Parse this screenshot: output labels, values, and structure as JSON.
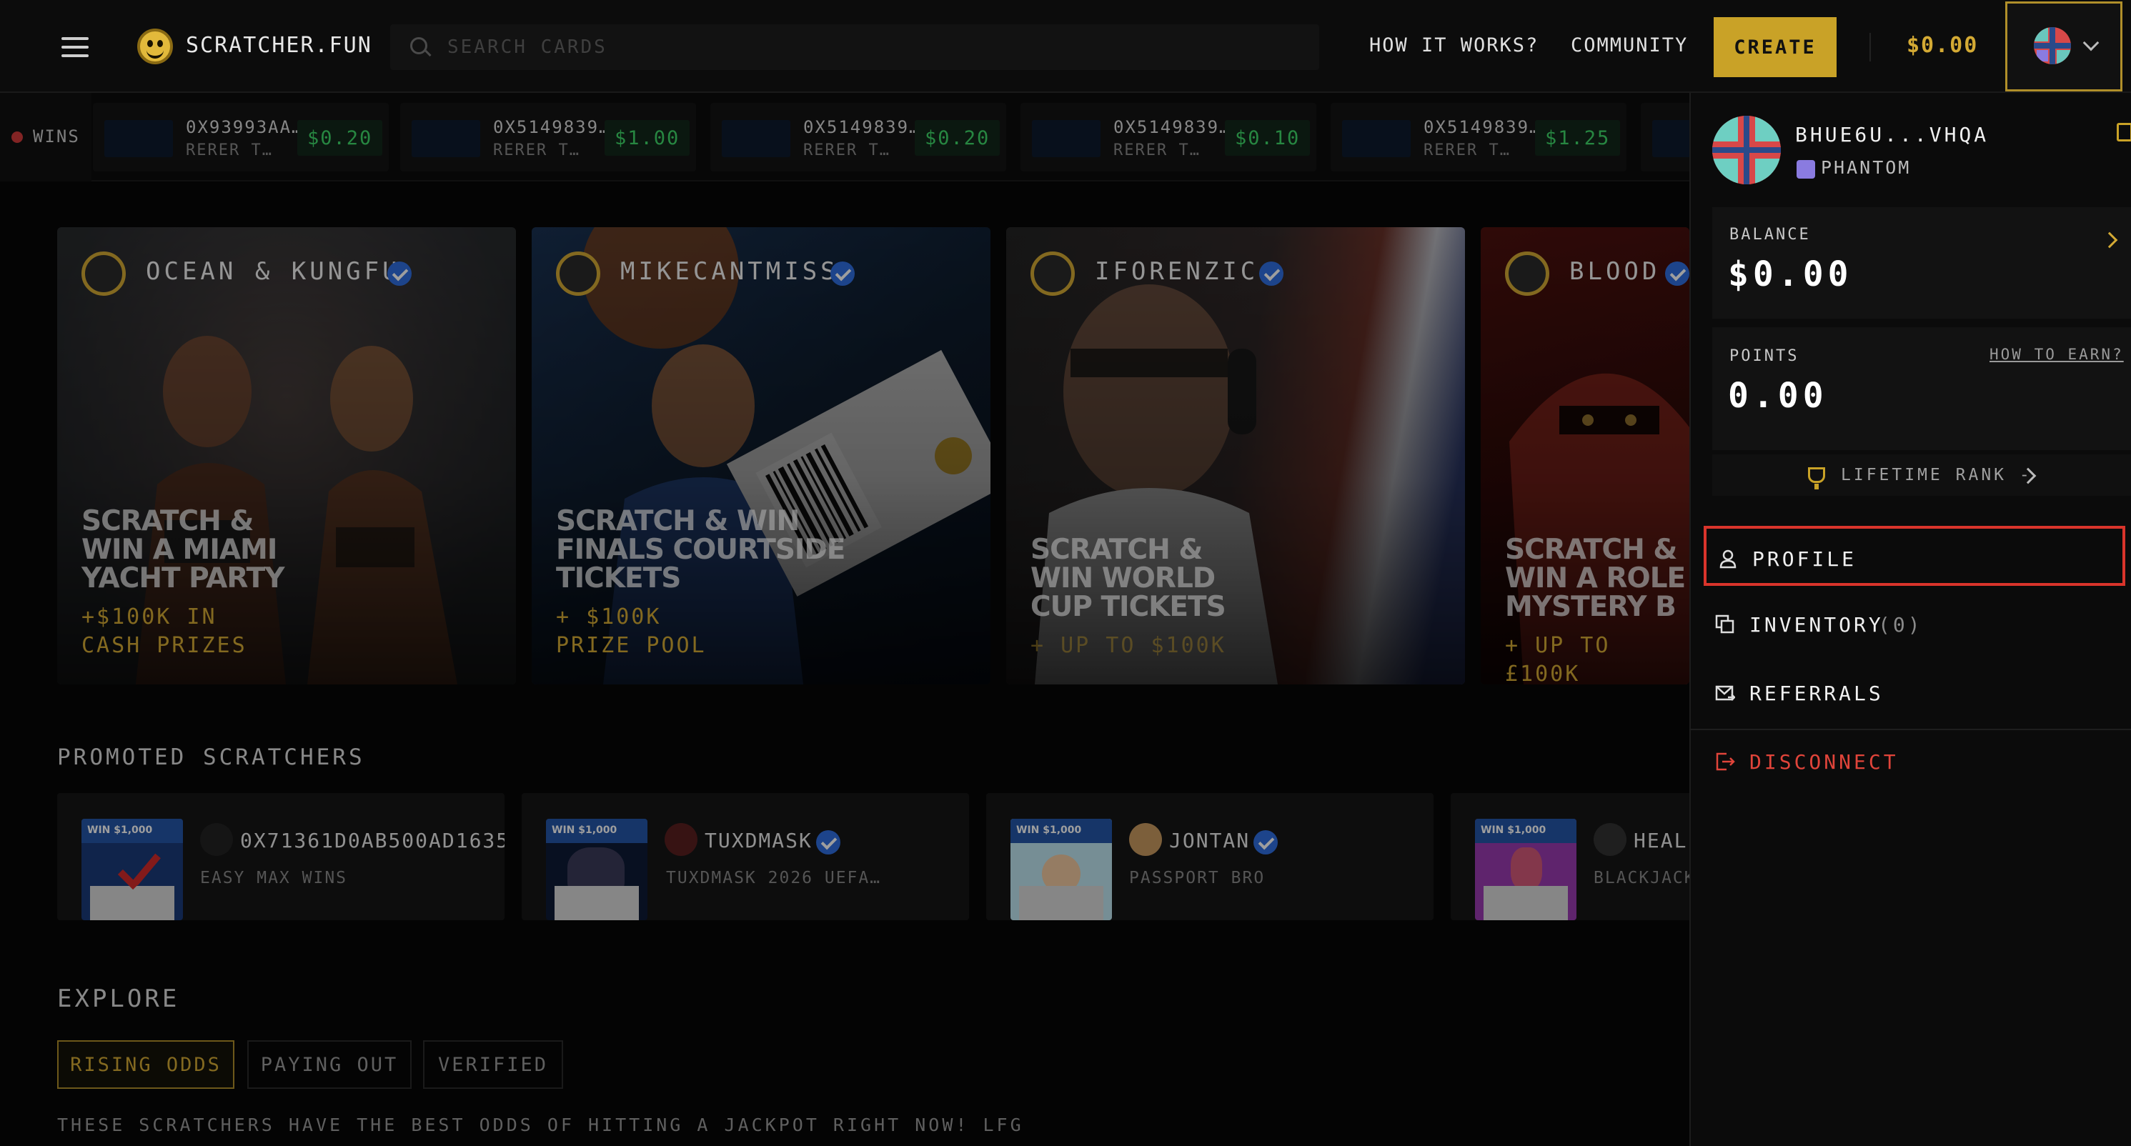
{
  "header": {
    "logo_text": "SCRATCHER.FUN",
    "search_placeholder": "SEARCH CARDS",
    "nav": [
      "HOW IT WORKS?",
      "COMMUNITY"
    ],
    "create_label": "CREATE",
    "balance": "$0.00",
    "accent_color": "#c9a227"
  },
  "wins_bar": {
    "label": "WINS",
    "items": [
      {
        "address": "0X93993AA…",
        "name": "RERER T…",
        "amount": "$0.20"
      },
      {
        "address": "0X5149839…",
        "name": "RERER T…",
        "amount": "$1.00"
      },
      {
        "address": "0X5149839…",
        "name": "RERER T…",
        "amount": "$0.20"
      },
      {
        "address": "0X5149839…",
        "name": "RERER T…",
        "amount": "$0.10"
      },
      {
        "address": "0X5149839…",
        "name": "RERER T…",
        "amount": "$1.25"
      }
    ]
  },
  "featured": [
    {
      "creator": "OCEAN & KUNGFU",
      "headline": [
        "SCRATCH &",
        "WIN A MIAMI",
        "YACHT PARTY"
      ],
      "prize": [
        "+$100K IN",
        "CASH PRIZES"
      ]
    },
    {
      "creator": "MIKECANTMISS",
      "headline": [
        "SCRATCH & WIN",
        "FINALS COURTSIDE",
        "TICKETS"
      ],
      "prize": [
        "+ $100K",
        "PRIZE POOL"
      ]
    },
    {
      "creator": "IFORENZIC",
      "headline": [
        "SCRATCH &",
        "WIN WORLD",
        "CUP TICKETS"
      ],
      "prize": [
        "+ UP TO $100K"
      ]
    },
    {
      "creator": "BLOOD",
      "headline": [
        "SCRATCH &",
        "WIN A ROLE",
        "MYSTERY B"
      ],
      "prize": [
        "+ UP TO £100K"
      ]
    }
  ],
  "promoted": {
    "title": "PROMOTED SCRATCHERS",
    "card_badge": "WIN $1,000",
    "items": [
      {
        "name": "0X71361D0AB500AD1635",
        "sub": "EASY MAX WINS"
      },
      {
        "name": "TUXDMASK",
        "sub": "TUXDMASK 2026 UEFA…"
      },
      {
        "name": "JONTAN",
        "sub": "PASSPORT BRO"
      },
      {
        "name": "HEAL",
        "sub": "BLACKJACK"
      }
    ]
  },
  "explore": {
    "title": "EXPLORE",
    "tabs": [
      "RISING ODDS",
      "PAYING OUT",
      "VERIFIED"
    ],
    "description": "THESE SCRATCHERS HAVE THE BEST ODDS OF HITTING A JACKPOT RIGHT NOW! LFG"
  },
  "panel": {
    "wallet": "BHUE6U...VHQA",
    "provider": "PHANTOM",
    "balance_label": "BALANCE",
    "balance_value": "$0.00",
    "points_label": "POINTS",
    "how_to_earn": "HOW TO EARN?",
    "points_value": "0.00",
    "rank_label": "LIFETIME RANK -",
    "menu": {
      "profile": "PROFILE",
      "inventory": "INVENTORY",
      "inventory_count": "(0)",
      "referrals": "REFERRALS",
      "disconnect": "DISCONNECT"
    },
    "disconnect_color": "#e0443a"
  }
}
